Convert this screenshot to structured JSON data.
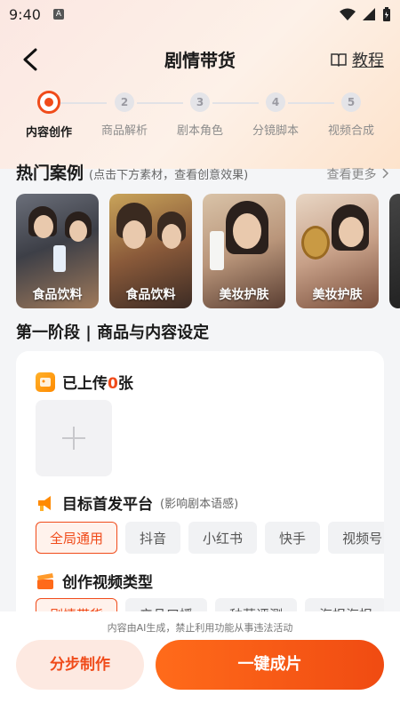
{
  "status": {
    "time": "9:40",
    "a_badge": "A"
  },
  "header": {
    "title": "剧情带货",
    "tutorial_label": "教程"
  },
  "steps": [
    {
      "num": "",
      "label": "内容创作",
      "active": true
    },
    {
      "num": "2",
      "label": "商品解析"
    },
    {
      "num": "3",
      "label": "剧本角色"
    },
    {
      "num": "4",
      "label": "分镜脚本"
    },
    {
      "num": "5",
      "label": "视频合成"
    }
  ],
  "hot": {
    "title": "热门案例",
    "hint": "(点击下方素材，查看创意效果)",
    "more": "查看更多"
  },
  "cases": [
    {
      "label": "食品饮料"
    },
    {
      "label": "食品饮料"
    },
    {
      "label": "美妆护肤"
    },
    {
      "label": "美妆护肤"
    }
  ],
  "stage": {
    "title": "第一阶段 | 商品与内容设定"
  },
  "uploaded": {
    "prefix": "已上传",
    "count": "0",
    "suffix": "张"
  },
  "platform": {
    "title": "目标首发平台",
    "hint": "(影响剧本语感)",
    "options": [
      "全局通用",
      "抖音",
      "小红书",
      "快手",
      "视频号"
    ]
  },
  "video_type": {
    "title": "创作视频类型",
    "options": [
      "剧情带货",
      "产品口播",
      "种草评测",
      "海报海报"
    ]
  },
  "notice": "内容由AI生成，禁止利用功能从事违法活动",
  "buttons": {
    "step": "分步制作",
    "one_click": "一键成片"
  },
  "colors": {
    "accent": "#f04b1a"
  }
}
